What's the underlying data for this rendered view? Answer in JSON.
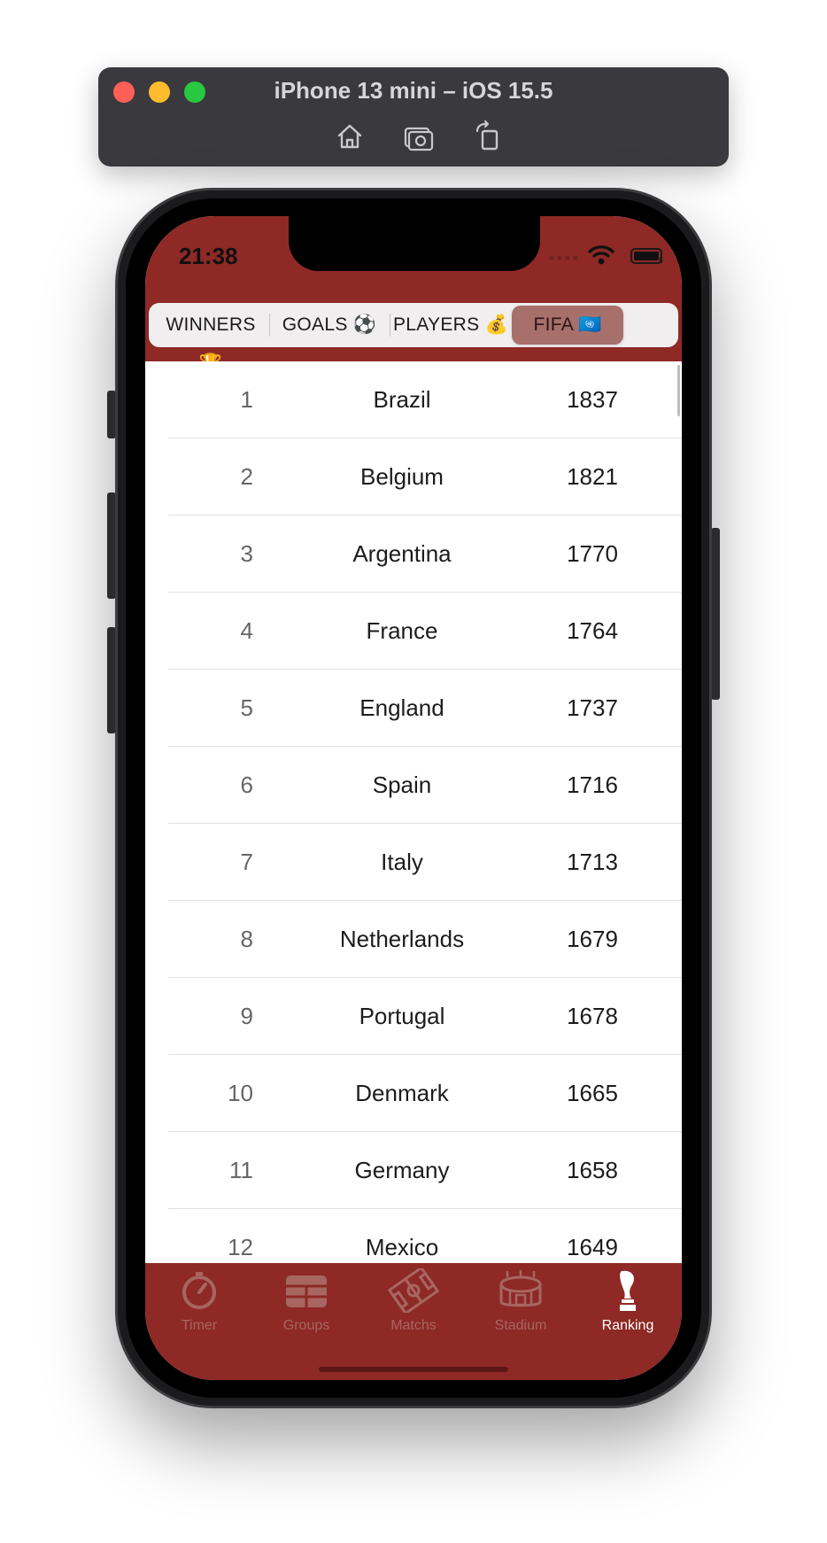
{
  "simulator": {
    "title": "iPhone 13 mini – iOS 15.5",
    "tools": [
      "home-icon",
      "screenshot-icon",
      "rotate-icon"
    ]
  },
  "status_bar": {
    "time": "21:38"
  },
  "segments": [
    {
      "label": "WINNERS 🏆",
      "selected": false
    },
    {
      "label": "GOALS ⚽",
      "selected": false
    },
    {
      "label": "PLAYERS 💰",
      "selected": false
    },
    {
      "label": "FIFA 🇺🇳",
      "selected": true
    }
  ],
  "ranking": [
    {
      "rank": "1",
      "team": "Brazil",
      "points": "1837"
    },
    {
      "rank": "2",
      "team": "Belgium",
      "points": "1821"
    },
    {
      "rank": "3",
      "team": "Argentina",
      "points": "1770"
    },
    {
      "rank": "4",
      "team": "France",
      "points": "1764"
    },
    {
      "rank": "5",
      "team": "England",
      "points": "1737"
    },
    {
      "rank": "6",
      "team": "Spain",
      "points": "1716"
    },
    {
      "rank": "7",
      "team": "Italy",
      "points": "1713"
    },
    {
      "rank": "8",
      "team": "Netherlands",
      "points": "1679"
    },
    {
      "rank": "9",
      "team": "Portugal",
      "points": "1678"
    },
    {
      "rank": "10",
      "team": "Denmark",
      "points": "1665"
    },
    {
      "rank": "11",
      "team": "Germany",
      "points": "1658"
    },
    {
      "rank": "12",
      "team": "Mexico",
      "points": "1649"
    }
  ],
  "tabs": [
    {
      "label": "Timer",
      "icon": "timer-icon",
      "selected": false
    },
    {
      "label": "Groups",
      "icon": "groups-icon",
      "selected": false
    },
    {
      "label": "Matchs",
      "icon": "field-icon",
      "selected": false
    },
    {
      "label": "Stadium",
      "icon": "stadium-icon",
      "selected": false
    },
    {
      "label": "Ranking",
      "icon": "trophy-icon",
      "selected": true
    }
  ],
  "colors": {
    "brand": "#8e2925",
    "segment_selected": "#a8706b",
    "tab_inactive": "#a76660",
    "tab_active": "#ffffff"
  }
}
